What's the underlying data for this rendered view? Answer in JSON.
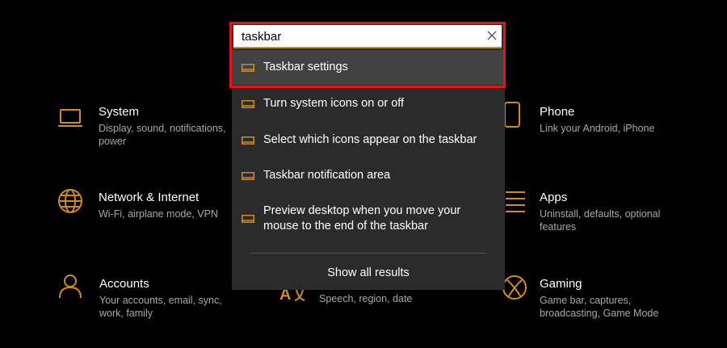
{
  "search": {
    "value": "taskbar",
    "results": [
      {
        "label": "Taskbar settings"
      },
      {
        "label": "Turn system icons on or off"
      },
      {
        "label": "Select which icons appear on the taskbar"
      },
      {
        "label": "Taskbar notification area"
      },
      {
        "label": "Preview desktop when you move your mouse to the end of the taskbar"
      }
    ],
    "show_all": "Show all results"
  },
  "tiles": {
    "system": {
      "title": "System",
      "desc": "Display, sound, notifications, power",
      "icon": "laptop-icon"
    },
    "phone": {
      "title": "Phone",
      "desc": "Link your Android, iPhone",
      "icon": "phone-icon"
    },
    "network": {
      "title": "Network & Internet",
      "desc": "Wi-Fi, airplane mode, VPN",
      "icon": "globe-icon"
    },
    "apps": {
      "title": "Apps",
      "desc": "Uninstall, defaults, optional features",
      "icon": "apps-list-icon"
    },
    "accounts": {
      "title": "Accounts",
      "desc": "Your accounts, email, sync, work, family",
      "icon": "person-icon"
    },
    "time_language": {
      "desc": "Speech, region, date",
      "icon": "language-icon"
    },
    "gaming": {
      "title": "Gaming",
      "desc": "Game bar, captures, broadcasting, Game Mode",
      "icon": "xbox-icon"
    }
  },
  "colors": {
    "accent": "#d08a2a",
    "highlight": "#e5141c",
    "panel": "#2b2b2b",
    "selected": "#424242"
  }
}
